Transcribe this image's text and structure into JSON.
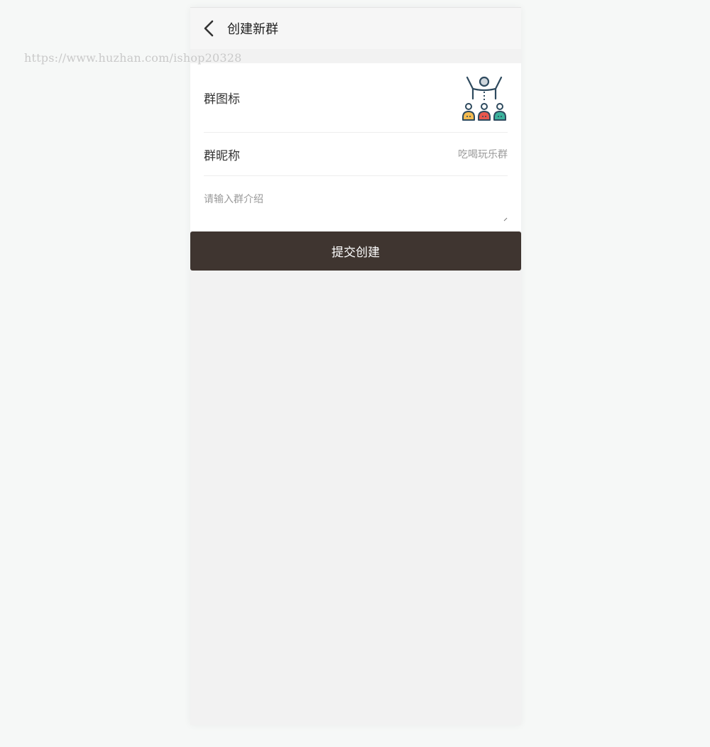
{
  "watermark": "https://www.huzhan.com/ishop20328",
  "header": {
    "back_icon": "chevron-left-icon",
    "title": "创建新群"
  },
  "form": {
    "icon_label": "群图标",
    "group_icon": "group-people-icon",
    "nickname_label": "群昵称",
    "nickname_value": "吃喝玩乐群",
    "intro_placeholder": "请输入群介绍",
    "intro_value": ""
  },
  "submit_label": "提交创建",
  "colors": {
    "submit_bg": "#3f3530",
    "page_bg": "#f2f2f2",
    "icon_navy": "#2e4a5e",
    "icon_yellow": "#f4bb50",
    "icon_red": "#e8574d",
    "icon_teal": "#3bb39d"
  }
}
